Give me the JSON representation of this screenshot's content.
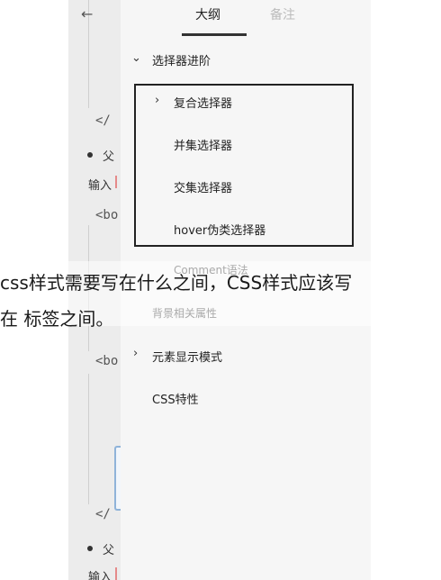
{
  "header": {
    "back_icon": "arrow-left-icon",
    "tabs": [
      {
        "label": "大纲",
        "active": true
      },
      {
        "label": "备注",
        "active": false
      }
    ]
  },
  "outline": {
    "section_title": "选择器进阶",
    "section_chevron": "chevron-down-icon",
    "items": [
      {
        "label": "复合选择器",
        "chevron": "chevron-right-icon"
      },
      {
        "label": "并集选择器"
      },
      {
        "label": "交集选择器"
      },
      {
        "label": "hover伪类选择器"
      }
    ],
    "faded_item": "Comment语法",
    "bg_item": "背景相关属性",
    "display_mode": {
      "label": "元素显示模式",
      "chevron": "chevron-right-icon"
    },
    "css_feature": "CSS特性"
  },
  "editor": {
    "lines": {
      "close_tag_1": "</",
      "bullet_1": "父",
      "input_1": "输入",
      "open_tag_1": "<bo",
      "open_tag_2": "<bo",
      "close_tag_2": "</",
      "bullet_2": "父",
      "input_2": "输入"
    }
  },
  "caption": {
    "line1": "css样式需要写在什么之间，CSS样式应该写",
    "line2": "在  标签之间。"
  },
  "colors": {
    "panel_bg": "#f6f6f6",
    "editor_bg": "#ececec",
    "highlight_border": "#222222",
    "active_tab_underline": "#333333"
  }
}
